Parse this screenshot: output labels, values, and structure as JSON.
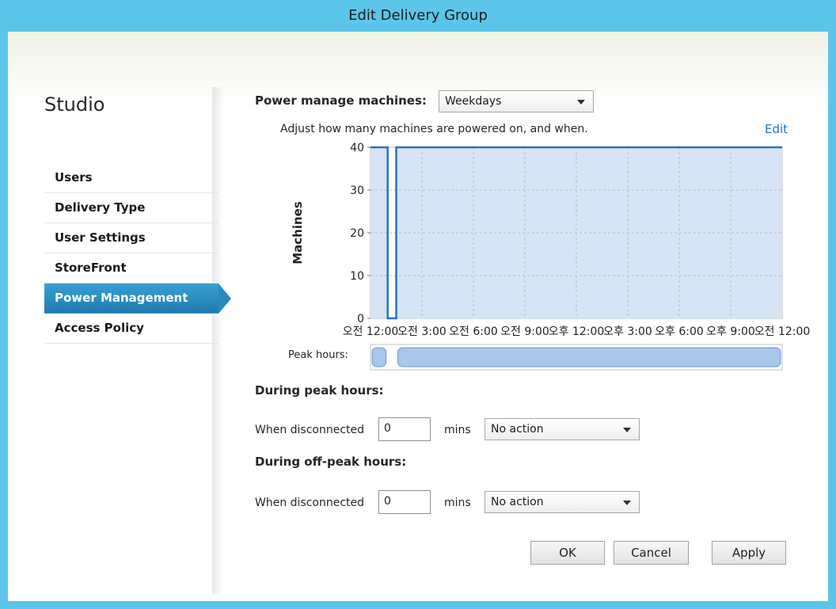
{
  "window": {
    "title": "Edit Delivery Group"
  },
  "sidebar": {
    "title": "Studio",
    "items": [
      {
        "label": "Users"
      },
      {
        "label": "Delivery Type"
      },
      {
        "label": "User Settings"
      },
      {
        "label": "StoreFront"
      },
      {
        "label": "Power Management",
        "active": true
      },
      {
        "label": "Access Policy"
      }
    ]
  },
  "power": {
    "manage_label": "Power manage machines:",
    "schedule_value": "Weekdays",
    "description": "Adjust how many machines are powered on, and when.",
    "edit_link": "Edit"
  },
  "chart_data": {
    "type": "area",
    "ylabel": "Machines",
    "ylim": [
      0,
      40
    ],
    "yticks": [
      "0",
      "10",
      "20",
      "30",
      "40"
    ],
    "x_tick_labels": [
      "오전 12:00",
      "오전 3:00",
      "오전 6:00",
      "오전 9:00",
      "오후 12:00",
      "오후 3:00",
      "오후 6:00",
      "오후 9:00",
      "오전 12:00"
    ],
    "x_hours": [
      0,
      1,
      1.5,
      24
    ],
    "series": [
      {
        "points": [
          [
            0,
            40
          ],
          [
            1,
            40
          ],
          [
            1,
            0
          ],
          [
            1.5,
            0
          ],
          [
            1.5,
            40
          ],
          [
            24,
            40
          ]
        ]
      }
    ],
    "grid": true,
    "peak_hours_label": "Peak hours:",
    "peak_ranges": [
      [
        0,
        1
      ],
      [
        1.5,
        24
      ]
    ],
    "colors": {
      "line": "#2a6fc4",
      "fill": "#d6e4f5",
      "peak": "#a9c6ec"
    }
  },
  "peak": {
    "heading": "During peak hours:",
    "disconnected_label": "When disconnected",
    "value": "0",
    "unit": "mins",
    "action": "No action"
  },
  "offpeak": {
    "heading": "During off-peak hours:",
    "disconnected_label": "When disconnected",
    "value": "0",
    "unit": "mins",
    "action": "No action"
  },
  "buttons": {
    "ok": "OK",
    "cancel": "Cancel",
    "apply": "Apply"
  }
}
